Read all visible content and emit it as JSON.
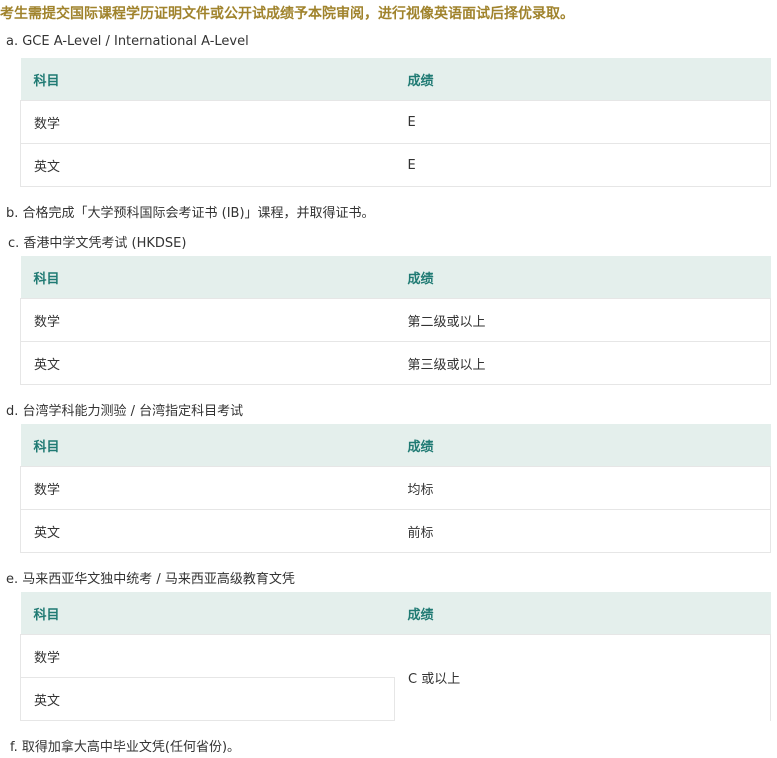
{
  "intro": "考生需提交国际课程学历证明文件或公开试成绩予本院审阅，进行视像英语面试后择优录取。",
  "sections": {
    "a": {
      "label": "a. GCE A-Level / International A-Level",
      "headers": [
        "科目",
        "成绩"
      ],
      "rows": [
        {
          "subject": "数学",
          "grade": "E"
        },
        {
          "subject": "英文",
          "grade": "E"
        }
      ]
    },
    "b": {
      "label": "b. 合格完成「大学预科国际会考证书 (IB)」课程，并取得证书。"
    },
    "c": {
      "label": "c. 香港中学文凭考试 (HKDSE)",
      "headers": [
        "科目",
        "成绩"
      ],
      "rows": [
        {
          "subject": "数学",
          "grade": "第二级或以上"
        },
        {
          "subject": "英文",
          "grade": "第三级或以上"
        }
      ]
    },
    "d": {
      "label": "d. 台湾学科能力测验 / 台湾指定科目考试",
      "headers": [
        "科目",
        "成绩"
      ],
      "rows": [
        {
          "subject": "数学",
          "grade": "均标"
        },
        {
          "subject": "英文",
          "grade": "前标"
        }
      ]
    },
    "e": {
      "label": "e. 马来西亚华文独中统考 / 马来西亚高级教育文凭",
      "headers": [
        "科目",
        "成绩"
      ],
      "rows": [
        {
          "subject": "数学"
        },
        {
          "subject": "英文"
        }
      ],
      "merged_grade": "C 或以上"
    },
    "f": {
      "label": "f. 取得加拿大高中毕业文凭(任何省份)。"
    }
  }
}
